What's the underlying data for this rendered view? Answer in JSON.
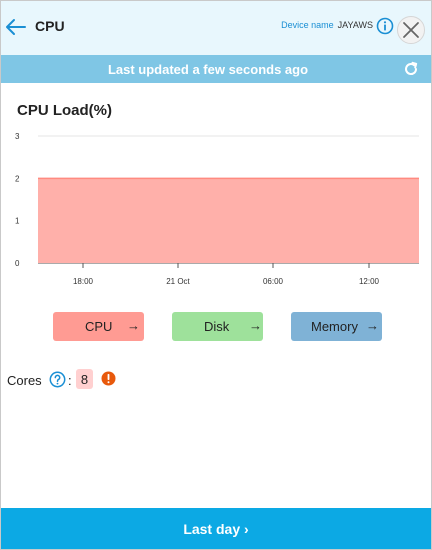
{
  "header": {
    "title": "CPU",
    "device_label": "Device name",
    "device_name": "JAYAWS",
    "back_icon": "arrow-left-icon",
    "info_icon": "info-icon",
    "close_icon": "close-icon"
  },
  "status": {
    "text": "Last updated a few seconds ago",
    "refresh_icon": "refresh-icon"
  },
  "chart_title": "CPU Load(%)",
  "chart_data": {
    "type": "area",
    "title": "CPU Load(%)",
    "x_ticks": [
      "18:00",
      "21 Oct",
      "06:00",
      "12:00"
    ],
    "y_ticks": [
      "0",
      "1",
      "2",
      "3"
    ],
    "ylim": [
      0,
      3
    ],
    "x": [
      "start",
      "end"
    ],
    "series": [
      {
        "values": [
          2,
          2
        ],
        "color": "#ffb0aa",
        "line_color": "#ff8a80"
      }
    ],
    "grid": true
  },
  "metrics": [
    {
      "label": "CPU",
      "arrow": "→",
      "color": "#ff9b93"
    },
    {
      "label": "Disk",
      "arrow": "→",
      "color": "#9ee19b"
    },
    {
      "label": "Memory",
      "arrow": "→",
      "color": "#7fb2d6"
    }
  ],
  "cores": {
    "label": "Cores",
    "colon": ":",
    "value": "8",
    "help_icon": "help-icon",
    "warning_icon": "warning-icon"
  },
  "footer": {
    "label": "Last day ›"
  },
  "colors": {
    "accent": "#0ca9e4",
    "status_bar": "#7fc6e5",
    "header_bg": "#e8f7fd",
    "warning": "#e8590c"
  }
}
